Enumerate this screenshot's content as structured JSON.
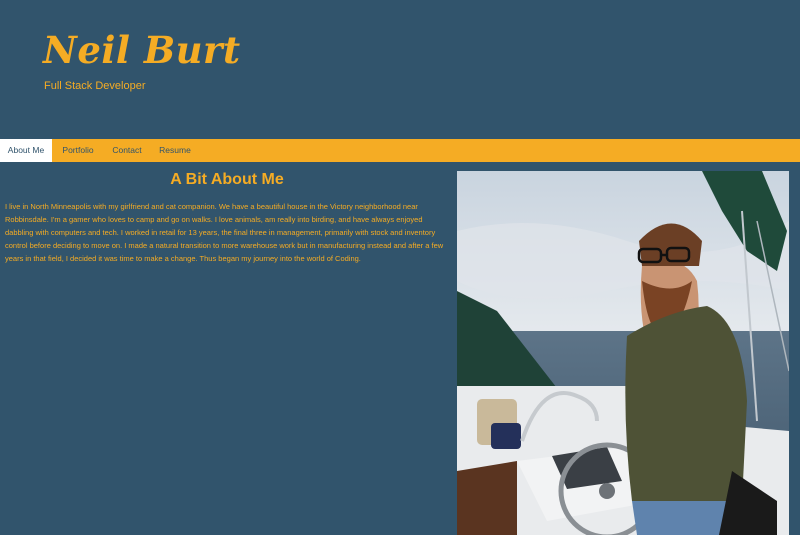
{
  "header": {
    "name": "Neil Burt",
    "title": "Full Stack Developer"
  },
  "nav": {
    "items": [
      "About Me",
      "Portfolio",
      "Contact",
      "Resume"
    ],
    "active": "About Me"
  },
  "about": {
    "heading": "A Bit About Me",
    "text": "I live in North Minneapolis with my girlfriend and cat companion. We have a beautiful house in the Victory neighborhood near Robbinsdale. I'm a gamer who loves to camp and go on walks. I love animals, am really into birding, and have always enjoyed dabbling with computers and tech. I worked in retail for 13 years, the final three in management, primarily with stock and inventory control before deciding to move on. I made a natural transition to more warehouse work but in manufacturing instead and after a few years in that field, I decided it was time to make a change. Thus began my journey into the world of Coding."
  },
  "colors": {
    "background": "#31546c",
    "accent": "#f5ac24",
    "nav_active": "#ffffff"
  }
}
